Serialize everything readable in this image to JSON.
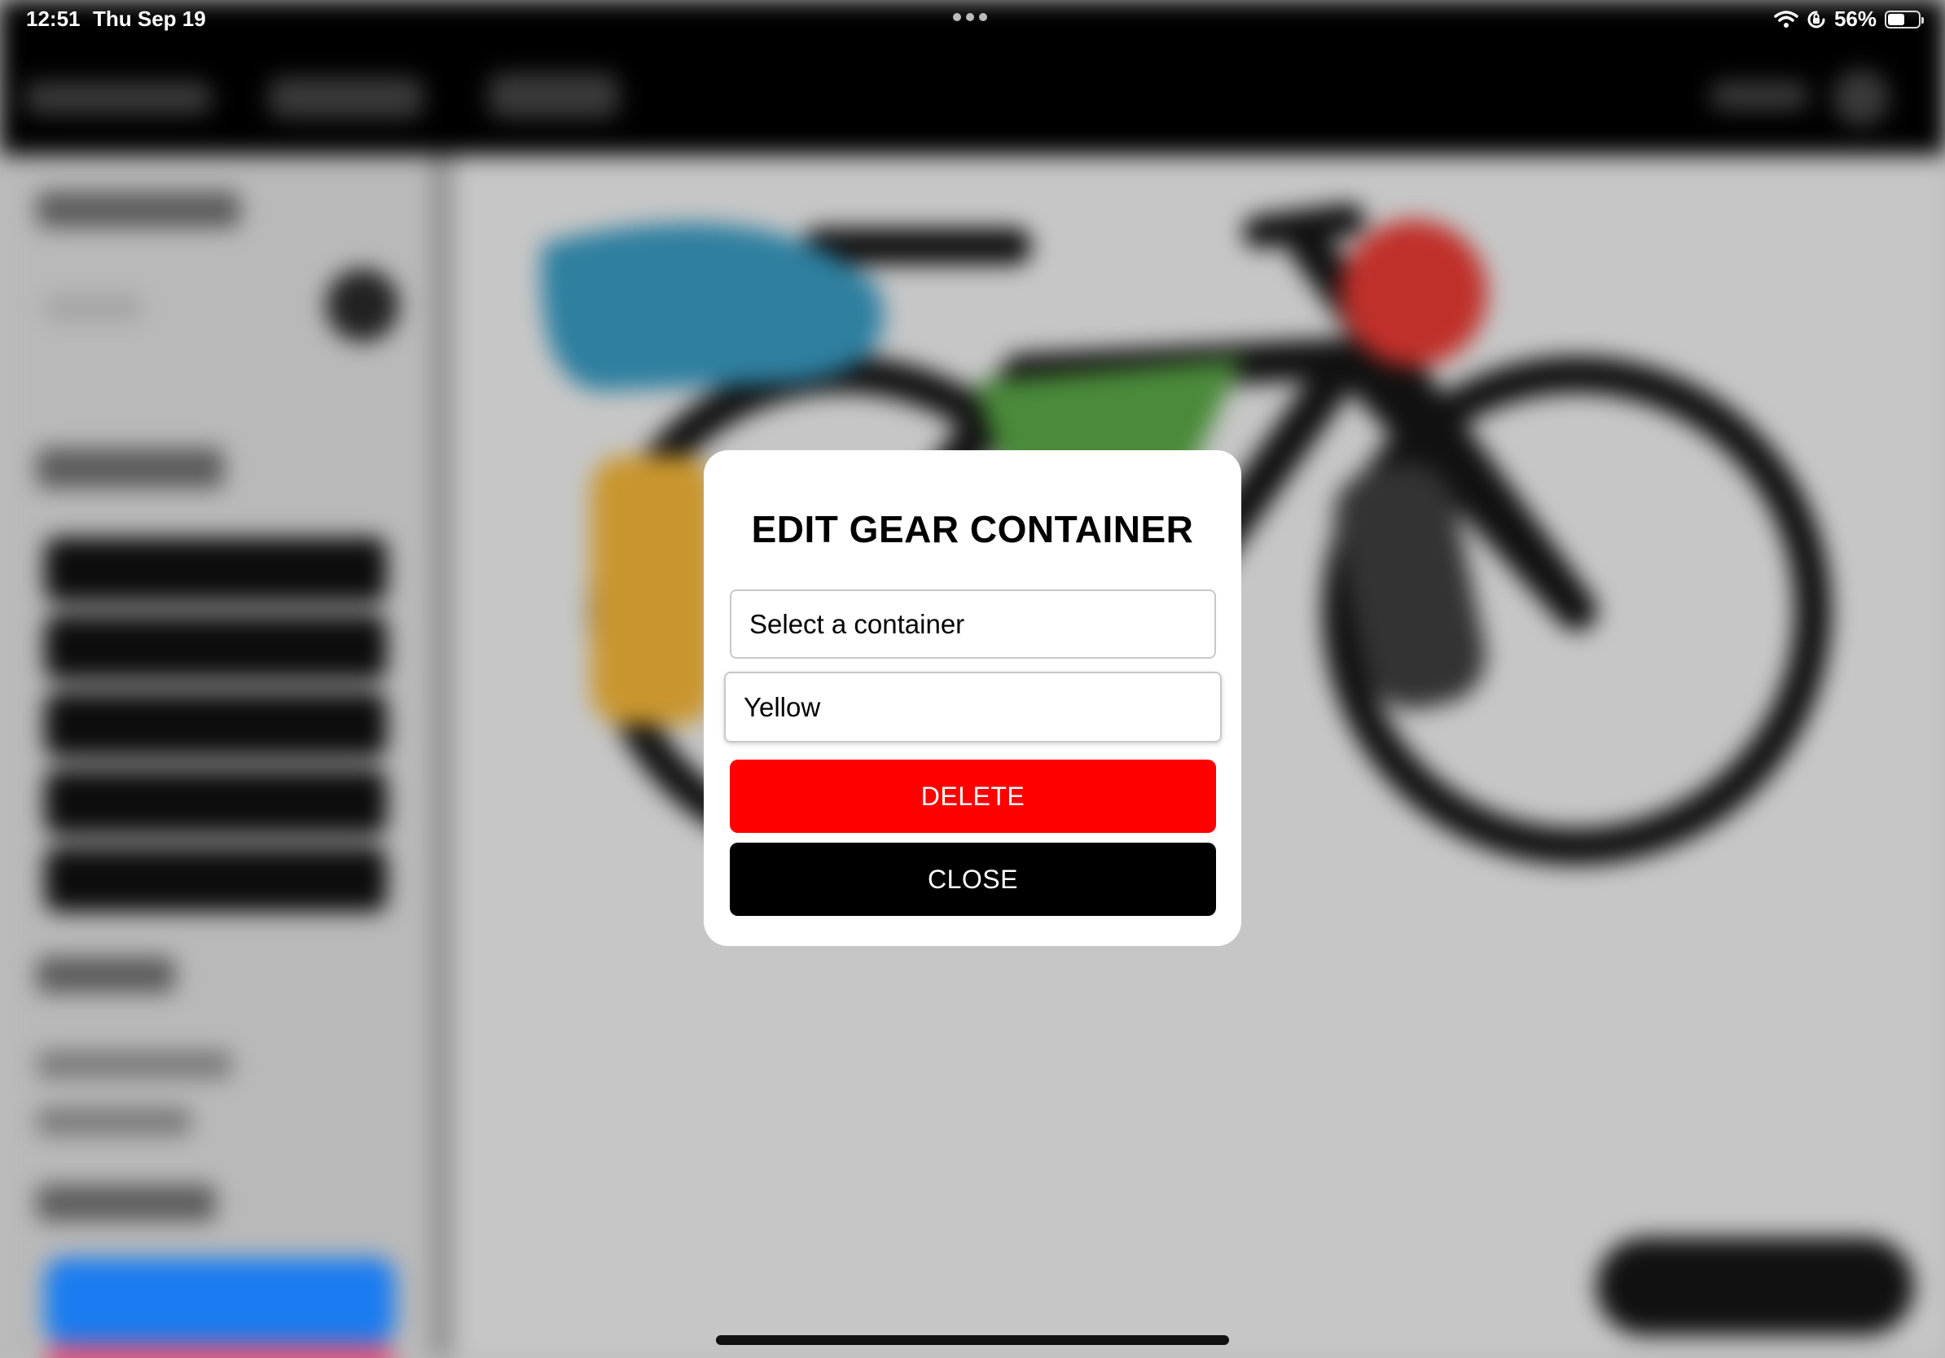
{
  "status_bar": {
    "time": "12:51",
    "date": "Thu Sep 19",
    "battery_percent": "56%",
    "battery_level": 0.56
  },
  "modal": {
    "title": "EDIT GEAR CONTAINER",
    "select": {
      "value": "Select a container"
    },
    "name_field": {
      "value": "Yellow"
    },
    "delete_label": "DELETE",
    "close_label": "CLOSE"
  },
  "colors": {
    "delete": "#ff0000",
    "close": "#000000",
    "bag_yellow": "#c9962e",
    "bag_blue": "#2e7fa0",
    "bag_green": "#4a8a3a",
    "bag_red": "#c0302a"
  },
  "icons": {
    "wifi": "wifi-icon",
    "orientation_lock": "orientation-lock-icon",
    "battery": "battery-icon",
    "multitasking": "multitasking-dots-icon"
  }
}
